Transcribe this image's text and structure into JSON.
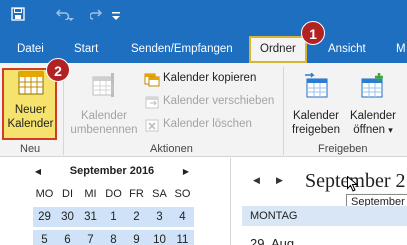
{
  "titlebar": {
    "quick_access": [
      "save-icon",
      "undo-icon",
      "redo-icon",
      "customize-dropdown-icon"
    ]
  },
  "tabs": [
    {
      "label": "Datei"
    },
    {
      "label": "Start"
    },
    {
      "label": "Senden/Empfangen"
    },
    {
      "label": "Ordner",
      "active": true
    },
    {
      "label": "Ansicht"
    },
    {
      "label": "M"
    }
  ],
  "annotations": {
    "badge_1": "1",
    "badge_2": "2",
    "highlight_color": "#d23a2a"
  },
  "ribbon": {
    "groups": {
      "new": {
        "label": "Neu",
        "new_calendar": {
          "line1": "Neuer",
          "line2": "Kalender"
        }
      },
      "actions": {
        "label": "Aktionen",
        "rename": {
          "line1": "Kalender",
          "line2": "umbenennen",
          "enabled": false
        },
        "copy": "Kalender kopieren",
        "move": "Kalender verschieben",
        "delete": "Kalender löschen"
      },
      "share": {
        "label": "Freigeben",
        "share_calendar": {
          "line1": "Kalender",
          "line2": "freigeben"
        },
        "open_calendar": {
          "line1": "Kalender",
          "line2": "öffnen",
          "dropdown": "▾"
        }
      }
    }
  },
  "mini_calendar": {
    "month": "September 2016",
    "prev": "◀",
    "next": "▶",
    "weekdays": [
      "MO",
      "DI",
      "MI",
      "DO",
      "FR",
      "SA",
      "SO"
    ],
    "weeks": [
      [
        "29",
        "30",
        "31",
        "1",
        "2",
        "3",
        "4"
      ],
      [
        "5",
        "6",
        "7",
        "8",
        "9",
        "10",
        "11"
      ]
    ]
  },
  "main_view": {
    "prev": "◀",
    "next": "▶",
    "title": "September 2",
    "tooltip": "September",
    "day_header": "MONTAG",
    "date": "29. Aug"
  },
  "colors": {
    "accent": "#1e6fc0",
    "selected_tab_border": "#d9b62e",
    "highlight_fill": "#f5e36d",
    "week_fill": "#cfe2f7",
    "badge": "#b22222"
  }
}
